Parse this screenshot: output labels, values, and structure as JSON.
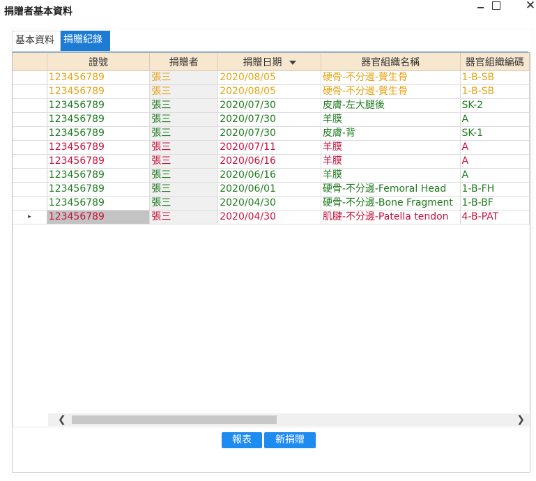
{
  "window": {
    "title": "捐贈者基本資料",
    "minimize_icon": "minimize-icon",
    "maximize_icon": "maximize-icon",
    "close_icon": "close-icon",
    "close_glyph": "✕"
  },
  "tabs": [
    {
      "label": "基本資料",
      "active": false
    },
    {
      "label": "捐贈紀錄",
      "active": true
    }
  ],
  "grid": {
    "columns": [
      "證號",
      "捐贈者",
      "捐贈日期",
      "器官組織名稱",
      "器官組織編碼"
    ],
    "sorted_column": "捐贈日期",
    "selected_row_marker": "▸",
    "rows": [
      {
        "id": "123456789",
        "donor": "張三",
        "date": "2020/08/05",
        "tissue": "硬骨-不分邊-贅生骨",
        "code": "1-B-SB",
        "color": "orange"
      },
      {
        "id": "123456789",
        "donor": "張三",
        "date": "2020/08/05",
        "tissue": "硬骨-不分邊-贅生骨",
        "code": "1-B-SB",
        "color": "orange"
      },
      {
        "id": "123456789",
        "donor": "張三",
        "date": "2020/07/30",
        "tissue": "皮膚-左大腿後",
        "code": "SK-2",
        "color": "green"
      },
      {
        "id": "123456789",
        "donor": "張三",
        "date": "2020/07/30",
        "tissue": "羊膜",
        "code": "A",
        "color": "green"
      },
      {
        "id": "123456789",
        "donor": "張三",
        "date": "2020/07/30",
        "tissue": "皮膚-背",
        "code": "SK-1",
        "color": "green"
      },
      {
        "id": "123456789",
        "donor": "張三",
        "date": "2020/07/11",
        "tissue": "羊膜",
        "code": "A",
        "color": "red"
      },
      {
        "id": "123456789",
        "donor": "張三",
        "date": "2020/06/16",
        "tissue": "羊膜",
        "code": "A",
        "color": "red"
      },
      {
        "id": "123456789",
        "donor": "張三",
        "date": "2020/06/16",
        "tissue": "羊膜",
        "code": "A",
        "color": "green"
      },
      {
        "id": "123456789",
        "donor": "張三",
        "date": "2020/06/01",
        "tissue": "硬骨-不分邊-Femoral Head",
        "code": "1-B-FH",
        "color": "green"
      },
      {
        "id": "123456789",
        "donor": "張三",
        "date": "2020/04/30",
        "tissue": "硬骨-不分邊-Bone Fragment",
        "code": "1-B-BF",
        "color": "green"
      },
      {
        "id": "123456789",
        "donor": "張三",
        "date": "2020/04/30",
        "tissue": "肌腱-不分邊-Patella tendon",
        "code": "4-B-PAT",
        "color": "red",
        "selected": true
      }
    ]
  },
  "scrollbar": {
    "left_glyph": "❮",
    "right_glyph": "❯"
  },
  "buttons": {
    "report": "報表",
    "new_donation": "新捐贈"
  },
  "colors": {
    "orange": "#e8a316",
    "green": "#1e7a1e",
    "red": "#c8103a",
    "accent": "#1e8bf0",
    "header_bg": "#f8e7cf"
  }
}
